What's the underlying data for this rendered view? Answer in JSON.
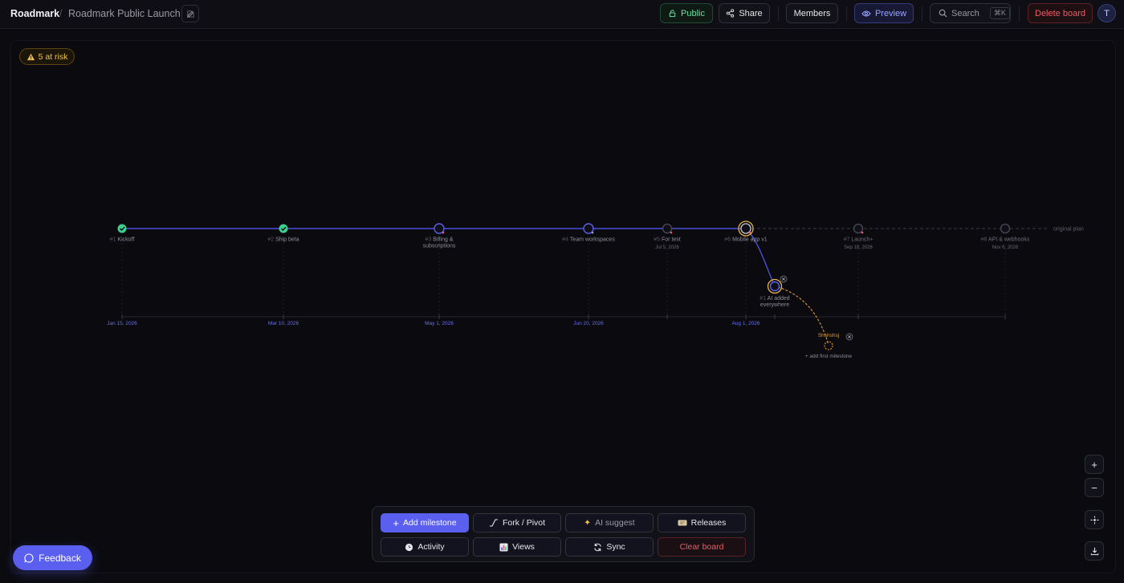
{
  "header": {
    "app_name": "Roadmark",
    "separator": "/",
    "board_name": "Roadmark Public Launch",
    "buttons": {
      "public": "Public",
      "share": "Share",
      "members": "Members",
      "preview": "Preview",
      "search": "Search",
      "search_shortcut": "⌘K",
      "delete": "Delete board"
    },
    "avatar_initial": "T"
  },
  "risk_badge": {
    "label": "5 at risk",
    "icon": "warning-icon"
  },
  "timeline": {
    "main_milestones": [
      {
        "num": "#1",
        "title": "Kickoff",
        "status": "done"
      },
      {
        "num": "#2",
        "title": "Ship beta",
        "status": "done"
      },
      {
        "num": "#3",
        "title_lines": [
          "Billing &",
          "subscriptions"
        ],
        "status": "in-progress"
      },
      {
        "num": "#4",
        "title": "Team workspaces",
        "status": "in-progress"
      },
      {
        "num": "#5",
        "title": "For test",
        "date": "Jul 5, 2026",
        "status": "planned"
      },
      {
        "num": "#6",
        "title": "Mobile app v1",
        "status": "fork-point"
      },
      {
        "num": "#7",
        "title": "Launch+",
        "date": "Sep 18, 2026",
        "status": "planned"
      },
      {
        "num": "#8",
        "title": "API & webhooks",
        "date": "Nov 6, 2026",
        "status": "planned"
      }
    ],
    "original_plan_label": "original plan",
    "axis_dates": [
      "Jan 15, 2026",
      "Mar 10, 2026",
      "May 1, 2026",
      "Jun 20, 2026",
      "Aug 1, 2026"
    ],
    "fork_milestone": {
      "num": "#1",
      "title_lines": [
        "AI added",
        "everywhere"
      ]
    },
    "branch": {
      "name": "Shshshsj",
      "add_label": "+ add first milestone"
    }
  },
  "toolbar": {
    "add_milestone": "Add milestone",
    "fork_pivot": "Fork / Pivot",
    "ai_suggest": "AI suggest",
    "releases": "Releases",
    "activity": "Activity",
    "views": "Views",
    "sync": "Sync",
    "clear_board": "Clear board"
  },
  "zoom_controls": {
    "zoom_in": "+",
    "zoom_out": "−"
  },
  "feedback": {
    "label": "Feedback"
  },
  "colors": {
    "accent": "#5b5fef",
    "done": "#3ecf8e",
    "warning": "#f3c04a",
    "danger": "#ef5a64",
    "branch": "#e69a2e"
  }
}
